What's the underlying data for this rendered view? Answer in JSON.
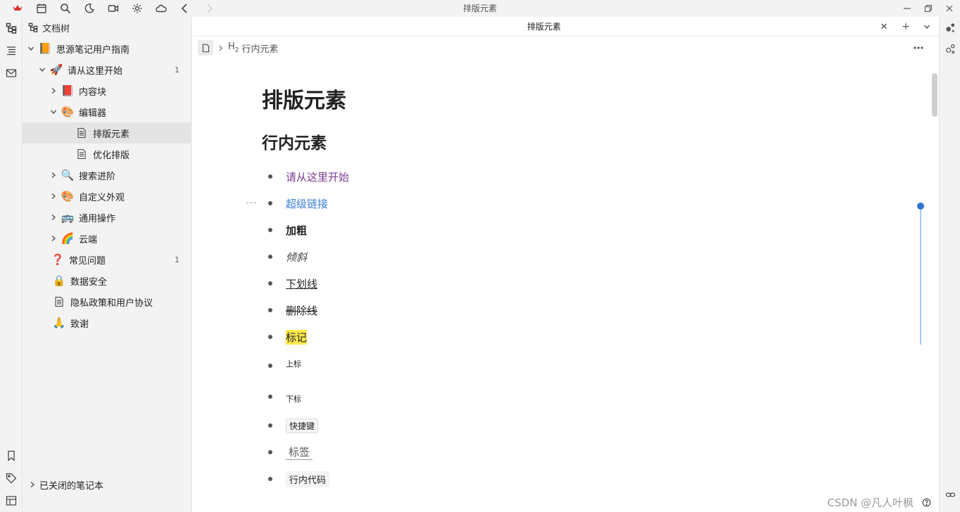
{
  "window": {
    "title": "排版元素"
  },
  "toolbar": {
    "icons": [
      "app-logo-icon",
      "calendar-icon",
      "search-icon",
      "moon-icon",
      "video-icon",
      "gear-icon",
      "cloud-icon",
      "back-icon",
      "forward-icon"
    ]
  },
  "sidebar": {
    "header": "文档树",
    "tree": [
      {
        "label": "思源笔记用户指南",
        "icon": "📙",
        "count": ""
      },
      {
        "label": "请从这里开始",
        "icon": "🚀",
        "count": "1"
      },
      {
        "label": "内容块",
        "icon": "📕",
        "count": ""
      },
      {
        "label": "编辑器",
        "icon": "🎨",
        "count": ""
      },
      {
        "label": "排版元素",
        "icon": "doc",
        "count": ""
      },
      {
        "label": "优化排版",
        "icon": "doc",
        "count": ""
      },
      {
        "label": "搜索进阶",
        "icon": "🔍",
        "count": ""
      },
      {
        "label": "自定义外观",
        "icon": "🎨",
        "count": ""
      },
      {
        "label": "通用操作",
        "icon": "🚌",
        "count": ""
      },
      {
        "label": "云端",
        "icon": "🌈",
        "count": ""
      },
      {
        "label": "常见问题",
        "icon": "❓",
        "count": "1"
      },
      {
        "label": "数据安全",
        "icon": "🔒",
        "count": ""
      },
      {
        "label": "隐私政策和用户协议",
        "icon": "doc",
        "count": ""
      },
      {
        "label": "致谢",
        "icon": "🙏",
        "count": ""
      }
    ],
    "closed_notebooks": "已关闭的笔记本"
  },
  "editor": {
    "tab_title": "排版元素",
    "breadcrumb": {
      "heading_level": "H",
      "heading_sub": "2",
      "heading": "行内元素"
    },
    "h1": "排版元素",
    "h2": "行内元素",
    "items": [
      "请从这里开始",
      "超级链接",
      "加粗",
      "倾斜",
      "下划线",
      "删除线",
      "标记",
      "上标",
      "下标",
      "快捷键",
      "标签",
      "行内代码"
    ]
  },
  "status": {
    "watermark": "CSDN @凡人叶枫"
  }
}
